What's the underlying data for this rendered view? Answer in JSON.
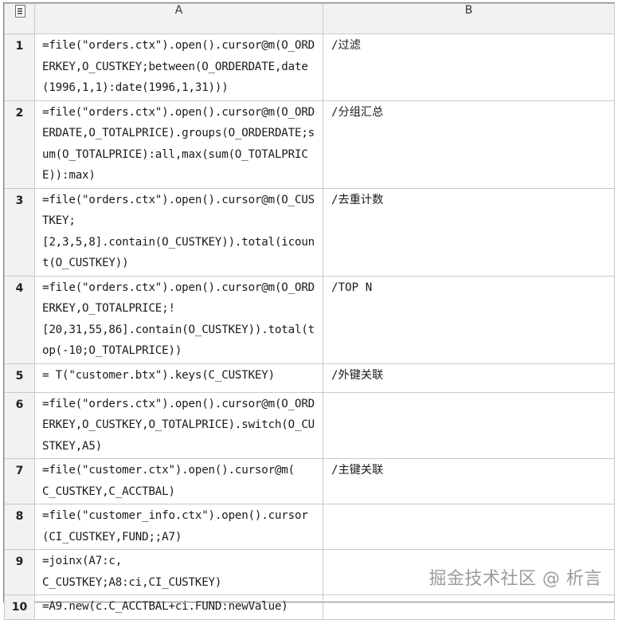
{
  "columns": {
    "corner_icon": "document-list-icon",
    "a": "A",
    "b": "B"
  },
  "rows": [
    {
      "num": "1",
      "a": "=file(\"orders.ctx\").open().cursor@m(O_ORDERKEY,O_CUSTKEY;between(O_ORDERDATE,date(1996,1,1):date(1996,1,31)))",
      "b": "/过滤"
    },
    {
      "num": "2",
      "a": "=file(\"orders.ctx\").open().cursor@m(O_ORDERDATE,O_TOTALPRICE).groups(O_ORDERDATE;sum(O_TOTALPRICE):all,max(sum(O_TOTALPRICE)):max)",
      "b": "/分组汇总"
    },
    {
      "num": "3",
      "a": "=file(\"orders.ctx\").open().cursor@m(O_CUSTKEY;\n[2,3,5,8].contain(O_CUSTKEY)).total(icount(O_CUSTKEY))",
      "b": "/去重计数"
    },
    {
      "num": "4",
      "a": "=file(\"orders.ctx\").open().cursor@m(O_ORDERKEY,O_TOTALPRICE;!\n[20,31,55,86].contain(O_CUSTKEY)).total(top(-10;O_TOTALPRICE))",
      "b": "/TOP N"
    },
    {
      "num": "5",
      "a": "= T(\"customer.btx\").keys(C_CUSTKEY)",
      "b": "/外键关联"
    },
    {
      "num": "6",
      "a": "=file(\"orders.ctx\").open().cursor@m(O_ORDERKEY,O_CUSTKEY,O_TOTALPRICE).switch(O_CUSTKEY,A5)",
      "b": ""
    },
    {
      "num": "7",
      "a": "=file(\"customer.ctx\").open().cursor@m(\nC_CUSTKEY,C_ACCTBAL)",
      "b": "/主键关联"
    },
    {
      "num": "8",
      "a": "=file(\"customer_info.ctx\").open().cursor(CI_CUSTKEY,FUND;;A7)",
      "b": ""
    },
    {
      "num": "9",
      "a": "=joinx(A7:c,\nC_CUSTKEY;A8:ci,CI_CUSTKEY)",
      "b": ""
    },
    {
      "num": "10",
      "a": "=A9.new(c.C_ACCTBAL+ci.FUND:newValue)",
      "b": ""
    }
  ],
  "watermark": "掘金技术社区 @ 析言"
}
